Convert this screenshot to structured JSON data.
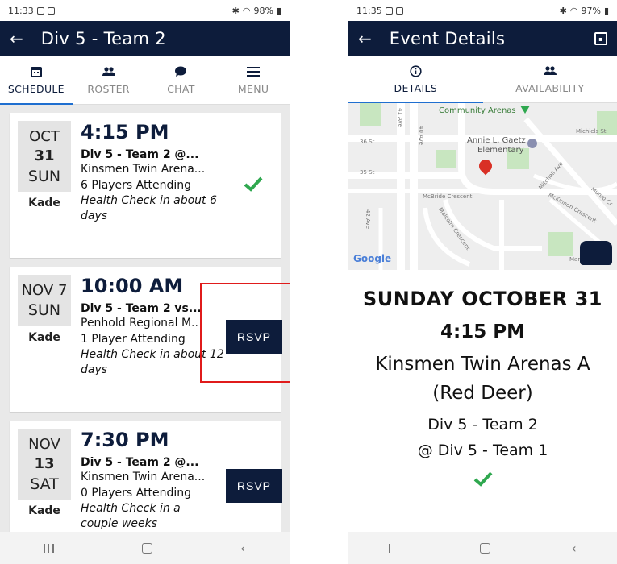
{
  "left": {
    "status": {
      "time": "11:33",
      "battery": "98%"
    },
    "appbar": {
      "title": "Div 5 - Team 2"
    },
    "tabs": [
      {
        "label": "SCHEDULE",
        "icon": "calendar-icon",
        "active": true
      },
      {
        "label": "ROSTER",
        "icon": "people-icon",
        "active": false
      },
      {
        "label": "CHAT",
        "icon": "chat-bubble-icon",
        "active": false
      },
      {
        "label": "MENU",
        "icon": "hamburger-menu-icon",
        "active": false
      }
    ],
    "events": [
      {
        "month": "OCT",
        "day": "31",
        "weekday": "SUN",
        "assignee": "Kade",
        "time": "4:15 PM",
        "title": "Div 5 - Team 2 @...",
        "venue": "Kinsmen Twin Arena...",
        "attending": "6 Players Attending",
        "health": "Health Check in about 6 days",
        "status": "attending"
      },
      {
        "month": "NOV 7",
        "day": "",
        "weekday": "SUN",
        "assignee": "Kade",
        "time": "10:00 AM",
        "title": "Div 5 - Team 2 vs...",
        "venue": "Penhold Regional M...",
        "attending": "1 Player Attending",
        "health": "Health Check in about 12 days",
        "rsvp_label": "RSVP"
      },
      {
        "month": "NOV",
        "day": "13",
        "weekday": "SAT",
        "assignee": "Kade",
        "time": "7:30 PM",
        "title": "Div 5 - Team 2 @...",
        "venue": "Kinsmen Twin Arena...",
        "attending": "0 Players Attending",
        "health": "Health Check in a couple weeks",
        "rsvp_label": "RSVP"
      }
    ]
  },
  "right": {
    "status": {
      "time": "11:35",
      "battery": "97%"
    },
    "appbar": {
      "title": "Event Details"
    },
    "tabs": [
      {
        "label": "DETAILS",
        "icon": "info-icon",
        "active": true
      },
      {
        "label": "AVAILABILITY",
        "icon": "people-icon",
        "active": false
      }
    ],
    "map": {
      "labels": {
        "community": "Community Arenas",
        "school_line1": "Annie L. Gaetz",
        "school_line2": "Elementary",
        "street_41": "41 Ave",
        "street_40": "40 Ave",
        "street_36": "36 St",
        "street_35": "35 St",
        "mcbride": "McBride Crescent",
        "malcolm": "Malcolm Crescent",
        "mitchell": "Mitchell Ave",
        "mckinnon": "McKinnon Crescent",
        "michiels": "Michiels St",
        "munro": "Munro Cr",
        "avenue_42": "42 Ave",
        "mar": "Mar",
        "google": "Google"
      }
    },
    "details": {
      "date": "SUNDAY OCTOBER 31",
      "time": "4:15 PM",
      "venue_line1": "Kinsmen Twin Arenas A",
      "venue_line2": "(Red Deer)",
      "home": "Div 5 - Team 2",
      "away": "@ Div 5 - Team 1"
    }
  },
  "colors": {
    "navy": "#0d1c3b",
    "accent_blue": "#1f6fd0",
    "check_green": "#2fa84f",
    "highlight_red": "#e01b1b"
  }
}
